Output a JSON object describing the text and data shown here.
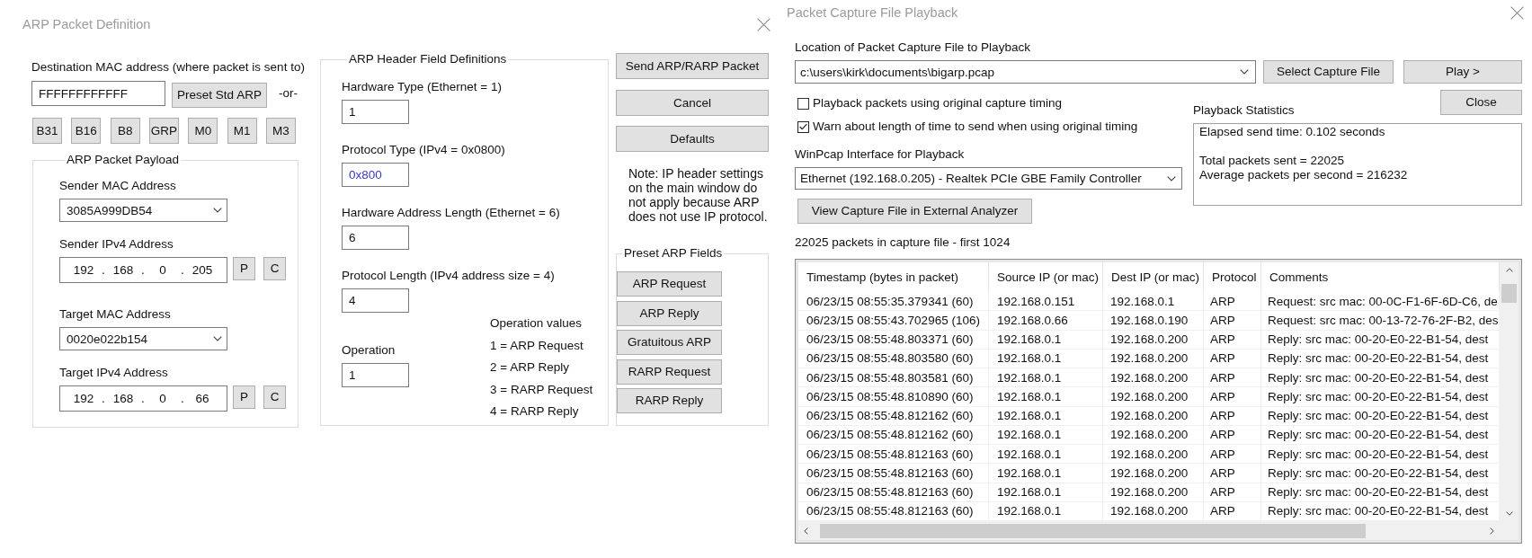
{
  "arp_dialog": {
    "title": "ARP Packet Definition",
    "destination": {
      "label": "Destination MAC address (where packet is sent to)",
      "value": "FFFFFFFFFFFF",
      "preset_button": "Preset Std ARP",
      "or_text": "-or-",
      "quick_buttons": [
        "B31",
        "B16",
        "B8",
        "GRP",
        "M0",
        "M1",
        "M3"
      ]
    },
    "payload": {
      "title": "ARP Packet Payload",
      "fields": [
        {
          "kind": "mac",
          "label": "Sender MAC Address",
          "value": "3085A999DB54"
        },
        {
          "kind": "ip",
          "label": "Sender IPv4 Address",
          "octets": [
            "192",
            "168",
            "0",
            "205"
          ],
          "separators": [
            ".",
            ".",
            "."
          ],
          "buttons": [
            "P",
            "C"
          ]
        },
        {
          "kind": "mac",
          "label": "Target MAC Address",
          "value": "0020e022b154"
        },
        {
          "kind": "ip",
          "label": "Target IPv4 Address",
          "octets": [
            "192",
            "168",
            "0",
            "66"
          ],
          "separators": [
            ".",
            ".",
            "."
          ],
          "buttons": [
            "P",
            "C"
          ]
        }
      ]
    },
    "header": {
      "title": "ARP Header Field Definitions",
      "fields": [
        {
          "kind": "field",
          "label": "Hardware Type (Ethernet = 1)",
          "value": "1",
          "highlighted": false
        },
        {
          "kind": "field",
          "label": "Protocol Type (IPv4 = 0x0800)",
          "value": "0x800",
          "highlighted": true
        },
        {
          "kind": "field",
          "label": "Hardware Address Length (Ethernet = 6)",
          "value": "6",
          "highlighted": false
        },
        {
          "kind": "field",
          "label": "Protocol Length (IPv4 address size = 4)",
          "value": "4",
          "highlighted": false
        },
        {
          "kind": "operation",
          "label": "Operation",
          "value": "1",
          "highlighted": false
        }
      ],
      "operation_values": {
        "title": "Operation values",
        "items": [
          "1 = ARP Request",
          "2 = ARP Reply",
          "3 = RARP Request",
          "4 = RARP Reply"
        ]
      }
    },
    "actions": [
      "Send ARP/RARP Packet",
      "Cancel",
      "Defaults"
    ],
    "note": "Note: IP header settings on the main window do not apply because ARP does not use IP protocol.",
    "presets": {
      "title": "Preset ARP Fields",
      "buttons": [
        "ARP Request",
        "ARP Reply",
        "Gratuitous ARP",
        "RARP Request",
        "RARP Reply"
      ]
    }
  },
  "playback_dialog": {
    "title": "Packet Capture File Playback",
    "file": {
      "label": "Location of Packet Capture File to Playback",
      "value": "c:\\users\\kirk\\documents\\bigarp.pcap"
    },
    "select_button": "Select Capture File",
    "play_button": "Play >",
    "close_button": "Close",
    "options": [
      {
        "label": "Playback packets using original capture timing",
        "checked": false
      },
      {
        "label": "Warn about length of time to send when using original timing",
        "checked": true
      }
    ],
    "interface": {
      "label": "WinPcap Interface for Playback",
      "value": "Ethernet (192.168.0.205) - Realtek PCIe GBE Family Controller"
    },
    "analyzer_button": "View Capture File in External Analyzer",
    "statistics": {
      "label": "Playback Statistics",
      "paragraphs": [
        [
          "Elapsed send time: 0.102 seconds"
        ],
        [
          "Total packets sent = 22025",
          "Average packets per second = 216232"
        ]
      ]
    },
    "capture_summary": "22025 packets in capture file - first 1024",
    "table": {
      "columns": [
        "Timestamp (bytes in packet)",
        "Source IP (or mac)",
        "Dest IP (or mac)",
        "Protocol",
        "Comments"
      ],
      "rows": [
        [
          "06/23/15 08:55:35.379341 (60)",
          "192.168.0.151",
          "192.168.0.1",
          "ARP",
          "Request: src mac: 00-0C-F1-6F-6D-C6, de"
        ],
        [
          "06/23/15 08:55:43.702965 (106)",
          "192.168.0.66",
          "192.168.0.190",
          "ARP",
          "Request: src mac: 00-13-72-76-2F-B2, des"
        ],
        [
          "06/23/15 08:55:48.803371 (60)",
          "192.168.0.1",
          "192.168.0.200",
          "ARP",
          "Reply: src mac: 00-20-E0-22-B1-54, dest"
        ],
        [
          "06/23/15 08:55:48.803580 (60)",
          "192.168.0.1",
          "192.168.0.200",
          "ARP",
          "Reply: src mac: 00-20-E0-22-B1-54, dest"
        ],
        [
          "06/23/15 08:55:48.803581 (60)",
          "192.168.0.1",
          "192.168.0.200",
          "ARP",
          "Reply: src mac: 00-20-E0-22-B1-54, dest"
        ],
        [
          "06/23/15 08:55:48.810890 (60)",
          "192.168.0.1",
          "192.168.0.200",
          "ARP",
          "Reply: src mac: 00-20-E0-22-B1-54, dest"
        ],
        [
          "06/23/15 08:55:48.812162 (60)",
          "192.168.0.1",
          "192.168.0.200",
          "ARP",
          "Reply: src mac: 00-20-E0-22-B1-54, dest"
        ],
        [
          "06/23/15 08:55:48.812162 (60)",
          "192.168.0.1",
          "192.168.0.200",
          "ARP",
          "Reply: src mac: 00-20-E0-22-B1-54, dest"
        ],
        [
          "06/23/15 08:55:48.812163 (60)",
          "192.168.0.1",
          "192.168.0.200",
          "ARP",
          "Reply: src mac: 00-20-E0-22-B1-54, dest"
        ],
        [
          "06/23/15 08:55:48.812163 (60)",
          "192.168.0.1",
          "192.168.0.200",
          "ARP",
          "Reply: src mac: 00-20-E0-22-B1-54, dest"
        ],
        [
          "06/23/15 08:55:48.812163 (60)",
          "192.168.0.1",
          "192.168.0.200",
          "ARP",
          "Reply: src mac: 00-20-E0-22-B1-54, dest"
        ],
        [
          "06/23/15 08:55:48.812163 (60)",
          "192.168.0.1",
          "192.168.0.200",
          "ARP",
          "Reply: src mac: 00-20-E0-22-B1-54, dest"
        ]
      ]
    }
  }
}
